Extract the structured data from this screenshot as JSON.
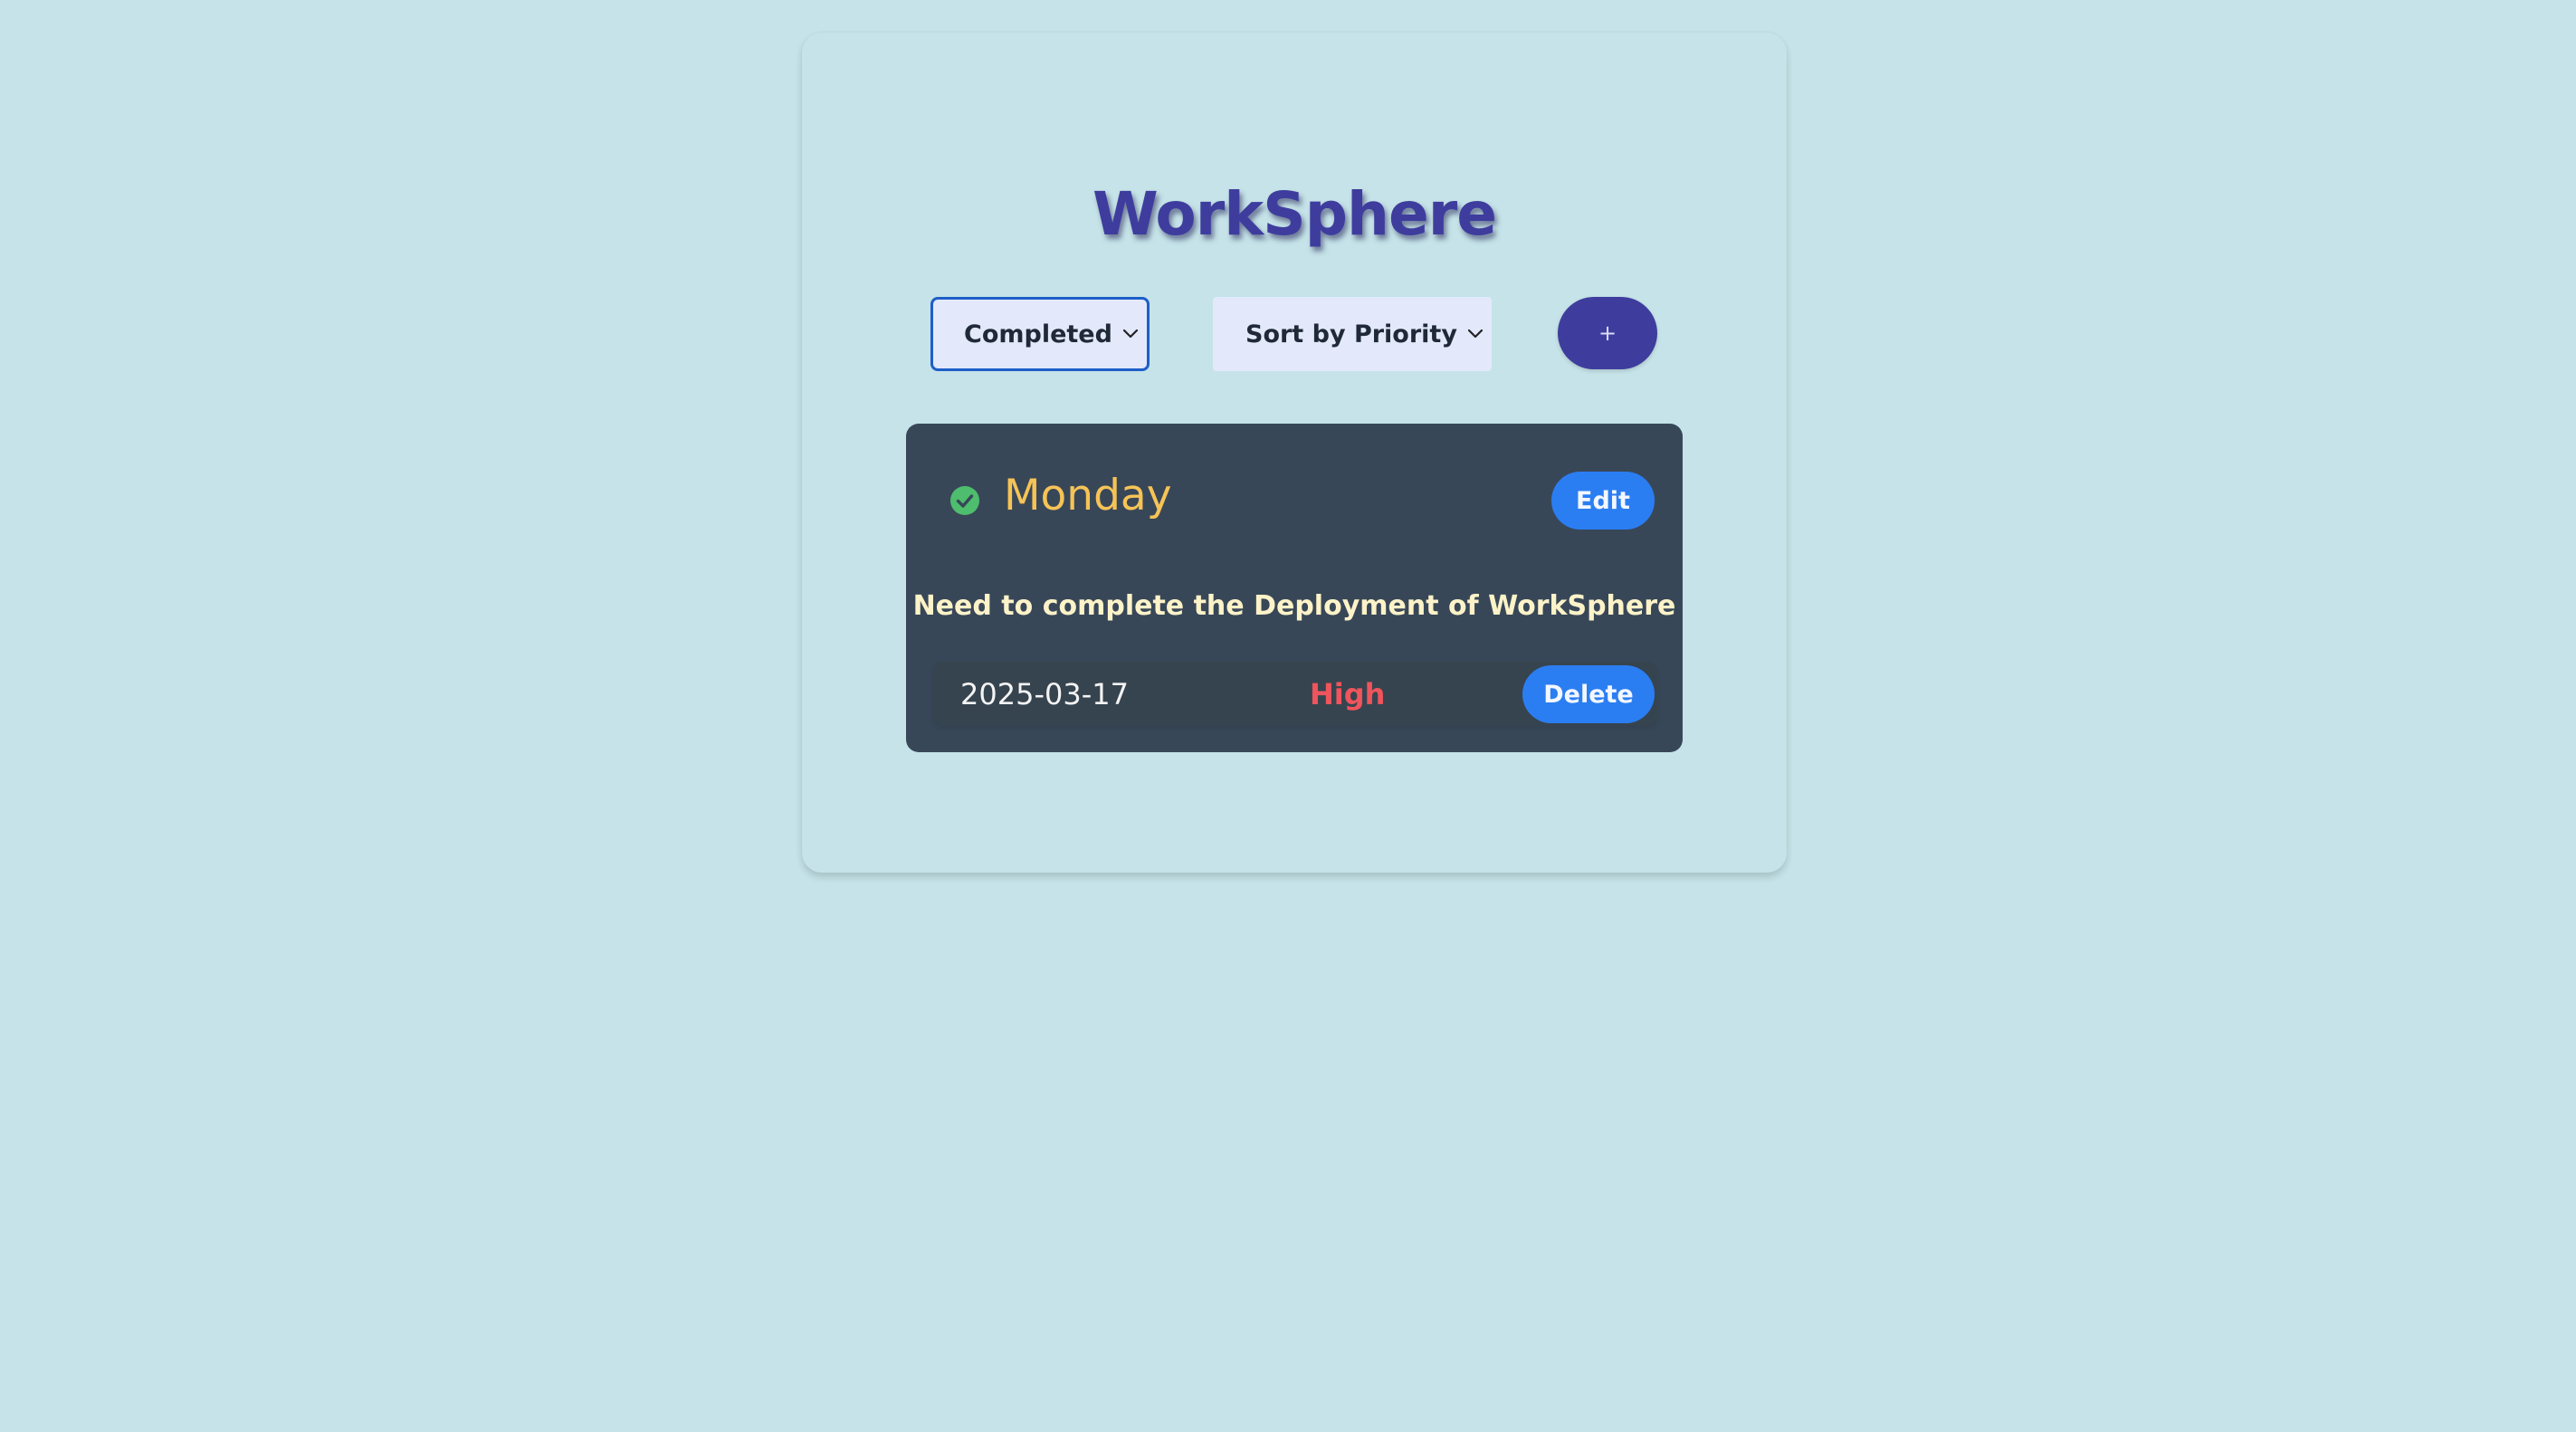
{
  "app": {
    "title": "WorkSphere"
  },
  "filters": {
    "status_selected": "Completed",
    "sort_selected": "Sort by Priority",
    "add_label": "+"
  },
  "tasks": [
    {
      "status": "completed",
      "status_icon": "check-circle-icon",
      "title": "Monday",
      "description": "Need to complete the Deployment of WorkSphere",
      "due_date": "2025-03-17",
      "priority": "High",
      "edit_label": "Edit",
      "delete_label": "Delete"
    }
  ],
  "colors": {
    "background": "#c5e3e8",
    "title": "#3e3d9e",
    "card": "#384758",
    "card_title": "#f6c356",
    "description": "#fdf3c8",
    "priority_high": "#f0545c",
    "button": "#2b7ef2",
    "completed_check": "#4ebd6e"
  }
}
